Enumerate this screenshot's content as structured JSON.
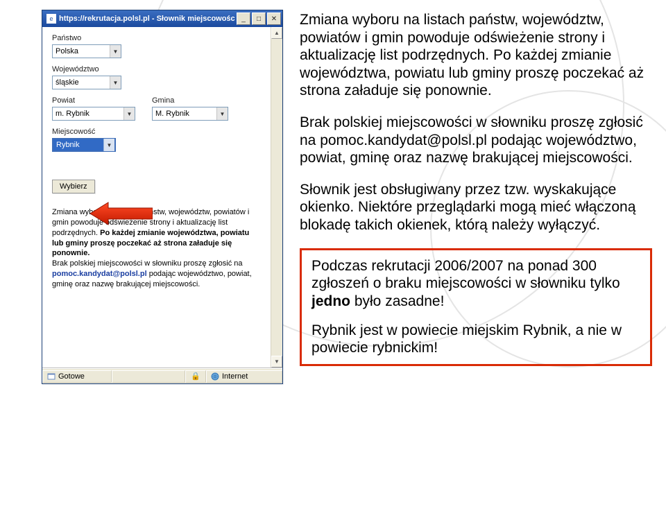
{
  "popup": {
    "title": "https://rekrutacja.polsl.pl - Słownik miejscowości - Micr...",
    "labels": {
      "panstwo": "Państwo",
      "wojewodztwo": "Województwo",
      "powiat": "Powiat",
      "gmina": "Gmina",
      "miejscowosc": "Miejscowość"
    },
    "values": {
      "panstwo": "Polska",
      "wojewodztwo": "śląskie",
      "powiat": "m. Rybnik",
      "gmina": "M. Rybnik",
      "miejscowosc": "Rybnik"
    },
    "button_wybierz": "Wybierz",
    "info": {
      "part1_a": "Zmiana wyboru na listach państw, województw, powiatów i gmin powoduje odświeżenie strony i aktualizację list podrzędnych. ",
      "part1_b": "Po każdej zmianie województwa, powiatu lub gminy proszę poczekać aż strona załaduje się ponownie.",
      "part2_a": "Brak polskiej miejscowości w słowniku proszę zgłosić na ",
      "part2_link": "pomoc.kandydat@polsl.pl",
      "part2_b": " podając województwo, powiat, gminę oraz nazwę brakującej miejscowości."
    },
    "status": {
      "done": "Gotowe",
      "zone": "Internet"
    }
  },
  "main": {
    "p1": "Zmiana wyboru na listach państw, województw, powiatów i gmin powoduje odświeżenie strony i aktualizację list podrzędnych. Po każdej zmianie województwa, powiatu lub gminy proszę poczekać aż strona załaduje się ponownie.",
    "p2": "Brak polskiej miejscowości w słowniku proszę zgłosić na pomoc.kandydat@polsl.pl podając województwo, powiat, gminę oraz nazwę brakującej miejscowości.",
    "p3": "Słownik jest obsługiwany przez tzw. wyskakujące okienko. Niektóre przeglądarki mogą mieć włączoną blokadę takich okienek, którą należy wyłączyć.",
    "callout1_a": "Podczas rekrutacji 2006/2007 na ponad 300 zgłoszeń o braku miejscowości w słowniku tylko ",
    "callout1_jedno": "jedno",
    "callout1_b": " było zasadne!",
    "callout2": "Rybnik jest w powiecie miejskim Rybnik, a nie w powiecie rybnickim!"
  }
}
